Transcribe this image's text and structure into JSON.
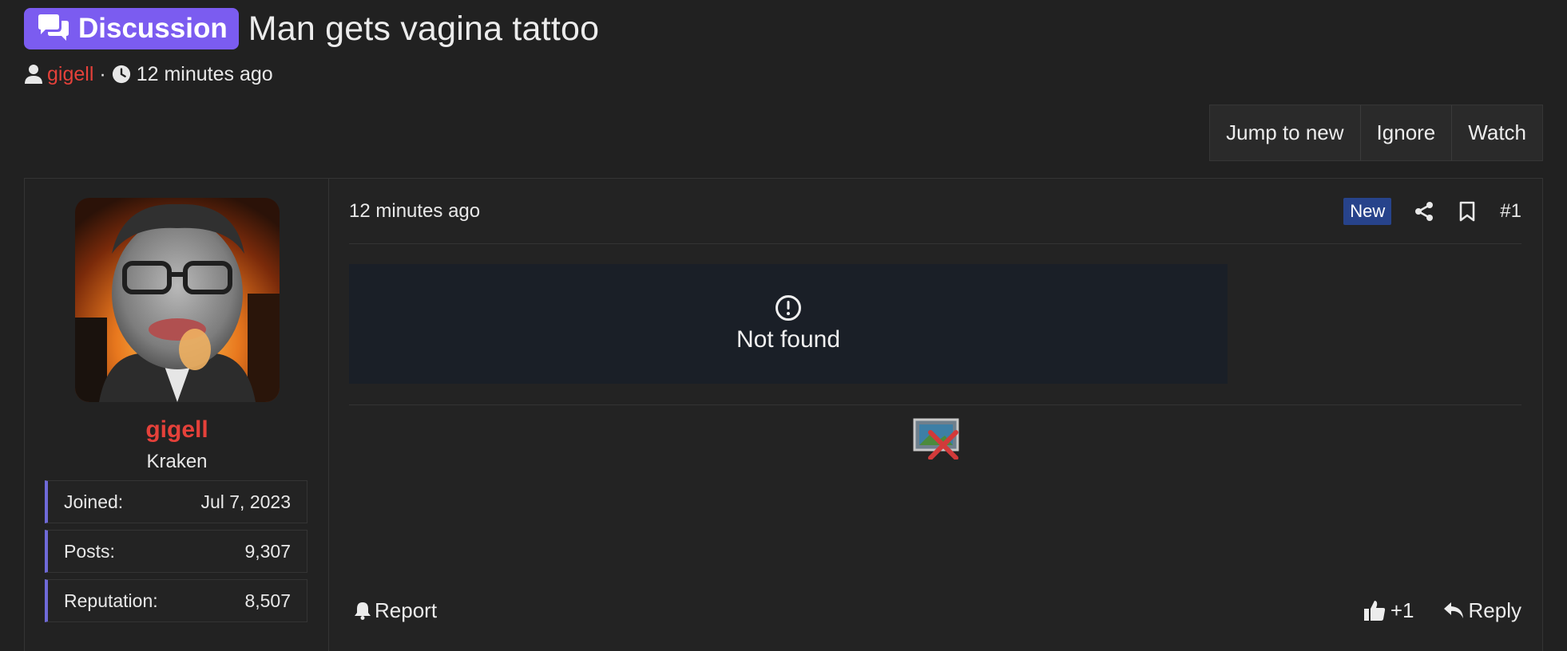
{
  "thread": {
    "prefix": "Discussion",
    "title": "Man gets vagina tattoo",
    "author": "gigell",
    "separator": "·",
    "time": "12 minutes ago"
  },
  "thread_actions": [
    "Jump to new",
    "Ignore",
    "Watch"
  ],
  "user": {
    "name": "gigell",
    "title": "Kraken",
    "stats": [
      {
        "label": "Joined:",
        "value": "Jul 7, 2023"
      },
      {
        "label": "Posts:",
        "value": "9,307"
      },
      {
        "label": "Reputation:",
        "value": "8,507"
      }
    ]
  },
  "post": {
    "time": "12 minutes ago",
    "badge": "New",
    "number": "#1",
    "embed_message": "Not found",
    "report_label": "Report",
    "like_count": "+1",
    "reply_label": "Reply"
  },
  "colors": {
    "background": "#212121",
    "prefix_badge": "#7b5cf0",
    "username": "#e5413a",
    "new_badge": "#27438b",
    "stat_accent": "#6f6ad8",
    "embed_bg": "#1a1f27"
  },
  "icons": {
    "prefix": "chat-bubbles-icon",
    "author": "user-icon",
    "time": "clock-icon",
    "share": "share-icon",
    "bookmark": "bookmark-icon",
    "embed": "exclamation-circle-icon",
    "broken_image": "broken-image-icon",
    "report": "bell-icon",
    "like": "thumbs-up-icon",
    "reply": "reply-arrow-icon"
  }
}
